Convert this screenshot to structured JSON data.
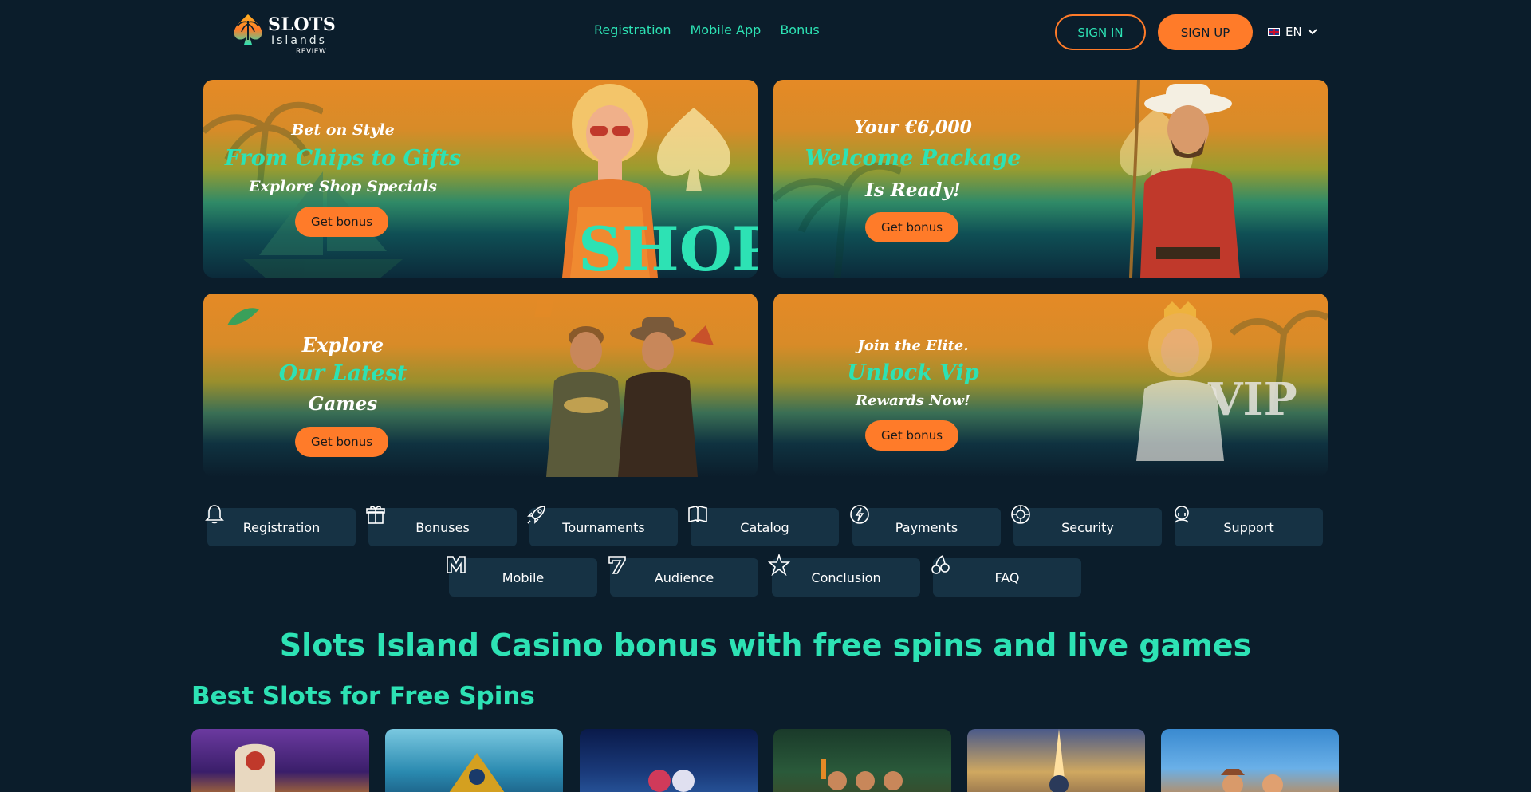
{
  "logo": {
    "line1": "SLOTS",
    "line2": "Islands",
    "line3": "REVIEW"
  },
  "nav": [
    {
      "label": "Registration"
    },
    {
      "label": "Mobile App"
    },
    {
      "label": "Bonus"
    }
  ],
  "auth": {
    "signin": "SIGN IN",
    "signup": "SIGN UP"
  },
  "lang": {
    "code": "EN"
  },
  "banners": [
    {
      "line1": "Bet on Style",
      "line2": "From Chips to Gifts",
      "line3": "Explore Shop Specials",
      "word": "SHOP",
      "button": "Get bonus"
    },
    {
      "line1": "Your €6,000",
      "line2": "Welcome Package",
      "line3": "Is Ready!",
      "button": "Get bonus"
    },
    {
      "line1": "Explore",
      "line2": "Our Latest",
      "line3": "Games",
      "button": "Get bonus"
    },
    {
      "line1": "Join the Elite.",
      "line2": "Unlock Vip",
      "line3": "Rewards Now!",
      "word": "VIP",
      "button": "Get bonus"
    }
  ],
  "categories": [
    {
      "label": "Registration",
      "icon": "bell-icon"
    },
    {
      "label": "Bonuses",
      "icon": "gift-icon"
    },
    {
      "label": "Tournaments",
      "icon": "rocket-icon"
    },
    {
      "label": "Catalog",
      "icon": "book-icon"
    },
    {
      "label": "Payments",
      "icon": "lightning-icon"
    },
    {
      "label": "Security",
      "icon": "shield-wheel-icon"
    },
    {
      "label": "Support",
      "icon": "headset-icon"
    },
    {
      "label": "Mobile",
      "icon": "m-logo-icon"
    },
    {
      "label": "Audience",
      "icon": "seven-icon"
    },
    {
      "label": "Conclusion",
      "icon": "star-icon"
    },
    {
      "label": "FAQ",
      "icon": "cherries-icon"
    }
  ],
  "headings": {
    "main": "Slots Island Casino bonus with free spins and live games",
    "sub": "Best Slots for Free Spins"
  },
  "colors": {
    "accent": "#2de2b4",
    "orange": "#ff7b29",
    "background": "#0b1d2b",
    "chip": "#163244"
  }
}
